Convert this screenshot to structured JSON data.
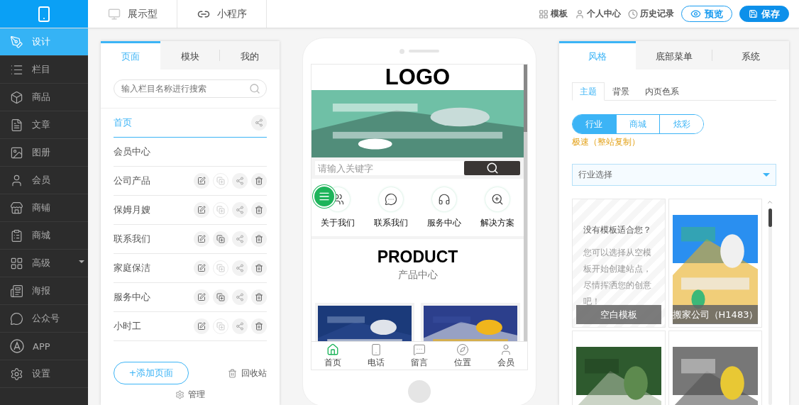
{
  "topbar": {
    "modes": [
      {
        "label": "展示型",
        "kind": "display"
      },
      {
        "label": "小程序",
        "kind": "mini"
      }
    ],
    "links": [
      {
        "label": "模板",
        "kind": "template"
      },
      {
        "label": "个人中心",
        "kind": "user"
      },
      {
        "label": "历史记录",
        "kind": "history"
      }
    ],
    "preview_button": "预览",
    "save_button": "保存"
  },
  "sidebar": {
    "items": [
      {
        "label": "设计",
        "kind": "design",
        "selected": true
      },
      {
        "label": "栏目",
        "kind": "list",
        "selected": false
      },
      {
        "label": "商品",
        "kind": "box",
        "selected": false
      },
      {
        "label": "文章",
        "kind": "article",
        "selected": false
      },
      {
        "label": "图册",
        "kind": "album",
        "selected": false
      },
      {
        "label": "会员",
        "kind": "member",
        "selected": false
      },
      {
        "label": "商铺",
        "kind": "shop",
        "selected": false
      },
      {
        "label": "商城",
        "kind": "mall",
        "selected": false
      },
      {
        "label": "高级",
        "kind": "advanced",
        "selected": false,
        "has_menu": true
      },
      {
        "label": "海报",
        "kind": "poster",
        "selected": false
      },
      {
        "label": "公众号",
        "kind": "wechat",
        "selected": false
      },
      {
        "label": "APP",
        "kind": "app",
        "selected": false
      },
      {
        "label": "设置",
        "kind": "settings",
        "selected": false
      }
    ]
  },
  "pages_panel": {
    "tabs": [
      {
        "label": "页面",
        "selected": true
      },
      {
        "label": "模块",
        "selected": false
      },
      {
        "label": "我的",
        "selected": false
      }
    ],
    "search": {
      "placeholder": "输入栏目名称进行搜索"
    },
    "pages": [
      {
        "name": "首页",
        "selected": true,
        "actions": [
          {
            "kind": "share",
            "disabled": false
          }
        ]
      },
      {
        "name": "会员中心",
        "selected": false
      },
      {
        "name": "公司产品",
        "selected": false,
        "actions": [
          {
            "kind": "edit",
            "disabled": false
          },
          {
            "kind": "copy",
            "disabled": true
          },
          {
            "kind": "share",
            "disabled": false
          },
          {
            "kind": "delete",
            "disabled": false
          }
        ]
      },
      {
        "name": "保姆月嫂",
        "selected": false,
        "actions": [
          {
            "kind": "edit",
            "disabled": false
          },
          {
            "kind": "copy",
            "disabled": true
          },
          {
            "kind": "share",
            "disabled": false
          },
          {
            "kind": "delete",
            "disabled": false
          }
        ]
      },
      {
        "name": "联系我们",
        "selected": false,
        "actions": [
          {
            "kind": "edit",
            "disabled": false
          },
          {
            "kind": "copy",
            "disabled": false
          },
          {
            "kind": "share",
            "disabled": false
          },
          {
            "kind": "delete",
            "disabled": false
          }
        ]
      },
      {
        "name": "家庭保洁",
        "selected": false,
        "actions": [
          {
            "kind": "edit",
            "disabled": false
          },
          {
            "kind": "copy",
            "disabled": true
          },
          {
            "kind": "share",
            "disabled": false
          },
          {
            "kind": "delete",
            "disabled": false
          }
        ]
      },
      {
        "name": "服务中心",
        "selected": false,
        "actions": [
          {
            "kind": "edit",
            "disabled": false
          },
          {
            "kind": "copy",
            "disabled": false
          },
          {
            "kind": "share",
            "disabled": false
          },
          {
            "kind": "delete",
            "disabled": false
          }
        ]
      },
      {
        "name": "小时工",
        "selected": false,
        "actions": [
          {
            "kind": "edit",
            "disabled": false
          },
          {
            "kind": "copy",
            "disabled": true
          },
          {
            "kind": "share",
            "disabled": false
          },
          {
            "kind": "delete",
            "disabled": false
          }
        ]
      }
    ],
    "add_button": "+添加页面",
    "recycle_bin": "回收站",
    "manage": "管理"
  },
  "phone": {
    "logo": "LOGO",
    "banner": {
      "kind": "picture"
    },
    "search": {
      "placeholder": "请输入关键字"
    },
    "quick_links": [
      {
        "label": "关于我们",
        "kind": "users"
      },
      {
        "label": "联系我们",
        "kind": "chat"
      },
      {
        "label": "服务中心",
        "kind": "headset"
      },
      {
        "label": "解决方案",
        "kind": "zoom"
      }
    ],
    "section_title": "PRODUCT",
    "section_subtitle": "产品中心",
    "products": [
      {
        "kind": "picture"
      },
      {
        "kind": "picture"
      }
    ],
    "bottom_nav": [
      {
        "label": "首页",
        "kind": "home",
        "selected": true
      },
      {
        "label": "电话",
        "kind": "phone",
        "selected": false
      },
      {
        "label": "留言",
        "kind": "message",
        "selected": false
      },
      {
        "label": "位置",
        "kind": "compass",
        "selected": false
      },
      {
        "label": "会员",
        "kind": "user",
        "selected": false
      }
    ]
  },
  "style_panel": {
    "tabs": [
      {
        "label": "风格",
        "selected": true
      },
      {
        "label": "底部菜单",
        "selected": false
      },
      {
        "label": "系统",
        "selected": false
      }
    ],
    "subtabs": [
      {
        "label": "主题",
        "selected": true
      },
      {
        "label": "背景",
        "selected": false
      },
      {
        "label": "内页色系",
        "selected": false
      }
    ],
    "segments": [
      {
        "label": "行业",
        "selected": true
      },
      {
        "label": "商城",
        "selected": false
      },
      {
        "label": "炫彩",
        "selected": false
      }
    ],
    "copy_link": "极速（整站复制）",
    "industry_select": {
      "placeholder": "行业选择"
    },
    "templates": [
      {
        "kind": "blank",
        "heading": "没有模板适合您？",
        "body": "您可以选择从空模板开始创建站点，尽情挥洒您的创意吧！",
        "caption": "空白模板"
      },
      {
        "kind": "picture",
        "caption": "搬家公司（H1483）"
      },
      {
        "kind": "picture"
      },
      {
        "kind": "picture"
      }
    ]
  }
}
